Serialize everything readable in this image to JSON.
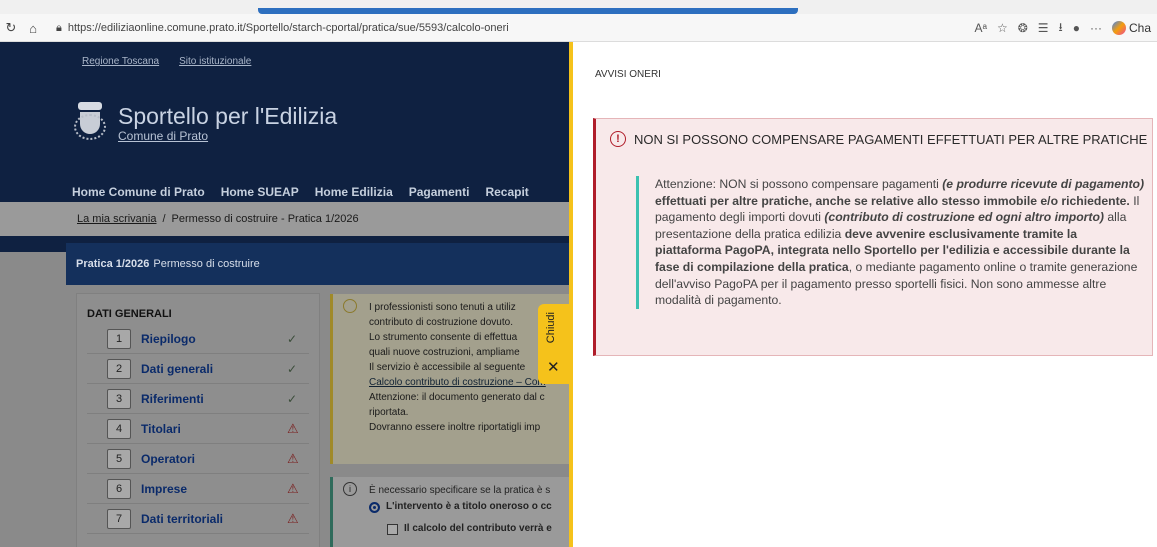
{
  "browser": {
    "url": "https://ediliziaonline.comune.prato.it/Sportello/starch-cportal/pratica/sue/5593/calcolo-oneri",
    "copilot_label": "Cha",
    "reload_icon": "reload-icon",
    "home_icon": "home-icon"
  },
  "site": {
    "top_links": [
      "Regione Toscana",
      "Sito istituzionale"
    ],
    "title": "Sportello per l'Edilizia",
    "subtitle": "Comune di Prato",
    "nav": [
      "Home Comune di Prato",
      "Home SUEAP",
      "Home Edilizia",
      "Pagamenti",
      "Recapit"
    ],
    "breadcrumb": {
      "link": "La mia scrivania",
      "sep": "/",
      "current": "Permesso di costruire - Pratica 1/2026"
    },
    "pratica_bar": {
      "bold": "Pratica 1/2026",
      "rest": "Permesso di costruire"
    },
    "left_heading": "DATI GENERALI",
    "left_items": [
      {
        "num": "1",
        "label": "Riepilogo",
        "status": "✓"
      },
      {
        "num": "2",
        "label": "Dati generali",
        "status": "✓"
      },
      {
        "num": "3",
        "label": "Riferimenti",
        "status": "✓"
      },
      {
        "num": "4",
        "label": "Titolari",
        "status": "⚠"
      },
      {
        "num": "5",
        "label": "Operatori",
        "status": "⚠"
      },
      {
        "num": "6",
        "label": "Imprese",
        "status": "⚠"
      },
      {
        "num": "7",
        "label": "Dati territoriali",
        "status": "⚠"
      }
    ],
    "note1": {
      "l1": "I professionisti sono tenuti a utiliz",
      "l2": "contributo di costruzione dovuto.",
      "l3": "Lo strumento consente di effettua",
      "l4": "quali nuove costruzioni, ampliame",
      "l5": "Il servizio è accessibile al seguente",
      "l6": "Calcolo contributo di costruzione – Com",
      "l7": "Attenzione: il documento generato dal c",
      "l8": "riportata.",
      "l9": "Dovranno essere inoltre riportatigli imp"
    },
    "note2": {
      "l1": "È necessario specificare se la pratica è s",
      "radio": "L'intervento è a titolo oneroso o cc",
      "checkbox": "Il calcolo del contributo verrà e"
    },
    "handle": {
      "label": "Chiudi",
      "close": "✕"
    }
  },
  "panel": {
    "title": "AVVISI ONERI",
    "alert_heading": "NON SI POSSONO COMPENSARE PAGAMENTI EFFETTUATI PER ALTRE PRATICHE",
    "alert_icon": "!",
    "body": {
      "p1": "Attenzione: NON si possono compensare pagamenti ",
      "i1": "(e produrre ricevute di pagamento)",
      "p2": " effettuati per altre pratiche, anche se relative allo stesso immobile e/o richiedente.",
      "p3": " Il pagamento degli importi dovuti ",
      "i2": "(contributo di costruzione ed ogni altro importo)",
      "p4": " alla presentazione della pratica edilizia ",
      "b1": "deve avvenire esclusivamente tramite la piattaforma PagoPA, integrata nello Sportello per l'edilizia e accessibile durante la fase di compilazione della pratica",
      "p5": ", o mediante pagamento online o tramite generazione dell'avviso PagoPA per il pagamento presso sportelli fisici. Non sono ammesse altre modalità di pagamento."
    }
  }
}
